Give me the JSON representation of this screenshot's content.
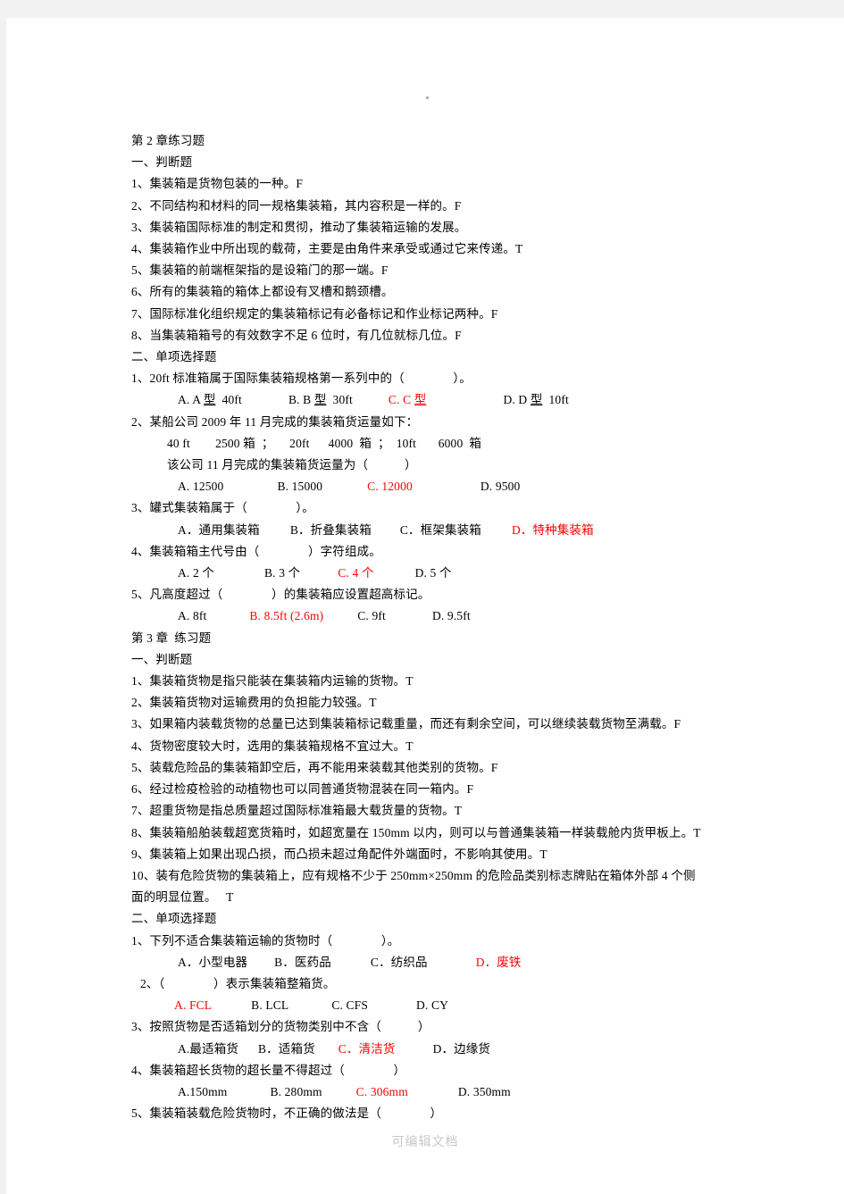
{
  "document": {
    "watermark": "可编辑文档",
    "chapter2": {
      "title": "第 2 章练习题",
      "section1_title": "一、判断题",
      "truefalse": [
        "1、集装箱是货物包装的一种。F",
        "2、不同结构和材料的同一规格集装箱，其内容积是一样的。F",
        "3、集装箱国际标准的制定和贯彻，推动了集装箱运输的发展。",
        "4、集装箱作业中所出现的载荷，主要是由角件来承受或通过它来传递。T",
        "5、集装箱的前端框架指的是设箱门的那一端。F",
        "6、所有的集装箱的箱体上都设有叉槽和鹅颈槽。",
        "7、国际标准化组织规定的集装箱标记有必备标记和作业标记两种。F",
        "8、当集装箱箱号的有效数字不足 6 位时，有几位就标几位。F"
      ],
      "section2_title": "二、单项选择题",
      "q1_stem": "1、20ft 标准箱属于国际集装箱规格第一系列中的（　　　　）。",
      "q1_opts": {
        "a_pre": "A. A ",
        "a_u": "型",
        "a_post": "  40ft",
        "b_pre": "B. B ",
        "b_u": "型",
        "b_post": "  30ft",
        "c_pre": "C. C ",
        "c_u": "型",
        "d_pre": "D. D ",
        "d_u": "型",
        "d_post": "  10ft"
      },
      "q2_stem": "2、某船公司 2009 年 11 月完成的集装箱货运量如下：",
      "q2_data": "40 ft        2500 箱  ；     20ft      4000  箱  ；  10ft       6000  箱",
      "q2_sub": "该公司 11 月完成的集装箱货运量为（　　　）",
      "q2_opts": {
        "a": "A. 12500",
        "b": "B. 15000",
        "c": "C. 12000",
        "d": "D. 9500"
      },
      "q3_stem": "3、罐式集装箱属于（　　　　）。",
      "q3_opts": {
        "a": "A．通用集装箱",
        "b": "B．折叠集装箱",
        "c": "C．框架集装箱",
        "d": "D．特种集装箱"
      },
      "q4_stem": "4、集装箱箱主代号由（　　　　）字符组成。",
      "q4_opts": {
        "a": "A. 2 个",
        "b": "B. 3 个",
        "c": "C. 4 个",
        "d": "D. 5 个"
      },
      "q5_stem": "5、凡高度超过（　　　　）的集装箱应设置超高标记。",
      "q5_opts": {
        "a": "A. 8ft",
        "b": "B. 8.5ft (2.6m)",
        "c": "C. 9ft",
        "d": "D. 9.5ft"
      }
    },
    "chapter3": {
      "title": "第 3 章  练习题",
      "section1_title": "一、判断题",
      "truefalse": [
        "1、集装箱货物是指只能装在集装箱内运输的货物。T",
        "2、集装箱货物对运输费用的负担能力较强。T",
        "3、如果箱内装载货物的总量已达到集装箱标记载重量，而还有剩余空间，可以继续装载货物至满载。F",
        "4、货物密度较大时，选用的集装箱规格不宜过大。T",
        "5、装载危险品的集装箱卸空后，再不能用来装载其他类别的货物。F",
        "6、经过检疫检验的动植物也可以同普通货物混装在同一箱内。F",
        "7、超重货物是指总质量超过国际标准箱最大载货量的货物。T",
        "8、集装箱船舶装载超宽货箱时，如超宽量在 150mm 以内，则可以与普通集装箱一样装载舱内货甲板上。T",
        "9、集装箱上如果出现凸损，而凸损未超过角配件外端面时，不影响其使用。T",
        "10、装有危险货物的集装箱上，应有规格不少于 250mm×250mm 的危险品类别标志牌贴在箱体外部 4 个侧",
        "面的明显位置。   T"
      ],
      "section2_title": "二、单项选择题",
      "q1_stem": "1、下列不适合集装箱运输的货物时（　　　　）。",
      "q1_opts": {
        "a": "A．小型电器",
        "b": "B．医药品",
        "c": "C．纺织品",
        "d": "D．废铁"
      },
      "q2_stem": "2、（　　　　）表示集装箱整箱货。",
      "q2_opts": {
        "a": "A. FCL",
        "b": "B. LCL",
        "c": "C. CFS",
        "d": "D. CY"
      },
      "q3_stem": "3、按照货物是否适箱划分的货物类别中不含（　　　）",
      "q3_opts": {
        "a": "A.最适箱货",
        "b": "B．适箱货",
        "c": "C．清洁货",
        "d": "D．边缘货"
      },
      "q4_stem": "4、集装箱超长货物的超长量不得超过（　　　　）",
      "q4_opts": {
        "a": "A.150mm",
        "b": "B. 280mm",
        "c": "C. 306mm",
        "d": "D. 350mm"
      },
      "q5_stem": "5、集装箱装载危险货物时，不正确的做法是（　　　　）"
    }
  }
}
